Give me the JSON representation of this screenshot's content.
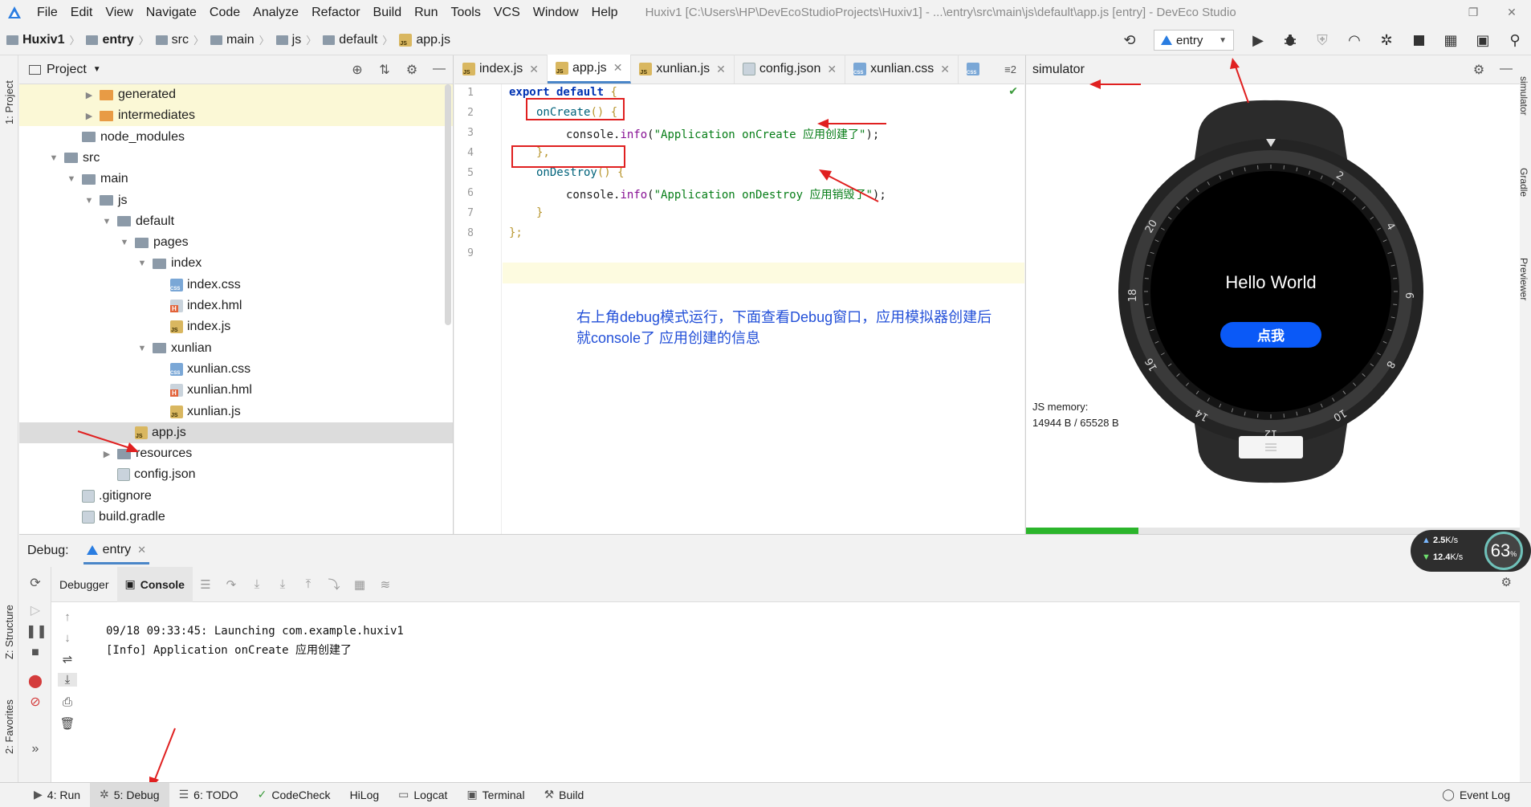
{
  "menu": {
    "items": [
      "File",
      "Edit",
      "View",
      "Navigate",
      "Code",
      "Analyze",
      "Refactor",
      "Build",
      "Run",
      "Tools",
      "VCS",
      "Window",
      "Help"
    ],
    "window_title": "Huxiv1 [C:\\Users\\HP\\DevEcoStudioProjects\\Huxiv1] - ...\\entry\\src\\main\\js\\default\\app.js [entry] - DevEco Studio"
  },
  "breadcrumb": [
    "Huxiv1",
    "entry",
    "src",
    "main",
    "js",
    "default",
    "app.js"
  ],
  "toolbar": {
    "run_config": "entry"
  },
  "left_strip": {
    "project": "1: Project",
    "structure": "Z: Structure",
    "favorites": "2: Favorites"
  },
  "project_panel": {
    "title": "Project",
    "tree": [
      {
        "label": "generated",
        "depth": 3,
        "type": "folder-orange",
        "arrow": "▶"
      },
      {
        "label": "intermediates",
        "depth": 3,
        "type": "folder-orange",
        "arrow": "▶"
      },
      {
        "label": "node_modules",
        "depth": 2,
        "type": "folder",
        "arrow": ""
      },
      {
        "label": "src",
        "depth": 1,
        "type": "folder",
        "arrow": "▼"
      },
      {
        "label": "main",
        "depth": 2,
        "type": "folder",
        "arrow": "▼"
      },
      {
        "label": "js",
        "depth": 3,
        "type": "folder",
        "arrow": "▼"
      },
      {
        "label": "default",
        "depth": 4,
        "type": "folder",
        "arrow": "▼"
      },
      {
        "label": "pages",
        "depth": 5,
        "type": "folder",
        "arrow": "▼"
      },
      {
        "label": "index",
        "depth": 6,
        "type": "folder",
        "arrow": "▼"
      },
      {
        "label": "index.css",
        "depth": 7,
        "type": "css",
        "arrow": ""
      },
      {
        "label": "index.hml",
        "depth": 7,
        "type": "hml",
        "arrow": ""
      },
      {
        "label": "index.js",
        "depth": 7,
        "type": "js",
        "arrow": ""
      },
      {
        "label": "xunlian",
        "depth": 6,
        "type": "folder",
        "arrow": "▼"
      },
      {
        "label": "xunlian.css",
        "depth": 7,
        "type": "css",
        "arrow": ""
      },
      {
        "label": "xunlian.hml",
        "depth": 7,
        "type": "hml",
        "arrow": ""
      },
      {
        "label": "xunlian.js",
        "depth": 7,
        "type": "js",
        "arrow": ""
      },
      {
        "label": "app.js",
        "depth": 5,
        "type": "js",
        "arrow": ""
      },
      {
        "label": "resources",
        "depth": 4,
        "type": "folder",
        "arrow": "▶"
      },
      {
        "label": "config.json",
        "depth": 4,
        "type": "json",
        "arrow": ""
      },
      {
        "label": ".gitignore",
        "depth": 2,
        "type": "file",
        "arrow": ""
      },
      {
        "label": "build.gradle",
        "depth": 2,
        "type": "file",
        "arrow": ""
      }
    ]
  },
  "editor": {
    "tabs": [
      {
        "label": "index.js",
        "icon": "js"
      },
      {
        "label": "app.js",
        "icon": "js"
      },
      {
        "label": "xunlian.js",
        "icon": "js"
      },
      {
        "label": "config.json",
        "icon": "json"
      },
      {
        "label": "xunlian.css",
        "icon": "css"
      }
    ],
    "tab_overflow": "≡2",
    "line_numbers": [
      "1",
      "2",
      "3",
      "4",
      "5",
      "6",
      "7",
      "8",
      "9"
    ],
    "code": {
      "l1_kw": "export default",
      "l1_brace": " {",
      "l2_fn": "onCreate",
      "l2_rest": "() {",
      "l3_obj": "console.",
      "l3_fn": "info",
      "l3_open": "(",
      "l3_str": "\"Application onCreate 应用创建了\"",
      "l3_close": ");",
      "l4": "},",
      "l5_fn": "onDestroy",
      "l5_rest": "() {",
      "l6_obj": "console.",
      "l6_fn": "info",
      "l6_open": "(",
      "l6_str": "\"Application onDestroy 应用销毁了\"",
      "l6_close": ");",
      "l7": "}",
      "l8": "};"
    },
    "annotation_line1": "右上角debug模式运行，下面查看Debug窗口，应用模拟器创建后",
    "annotation_line2": "就console了 应用创建的信息"
  },
  "simulator": {
    "title": "simulator",
    "screen_text": "Hello World",
    "button_label": "点我",
    "bezel_numbers": [
      "2",
      "4",
      "6",
      "8",
      "10",
      "12",
      "14",
      "16",
      "18",
      "20"
    ],
    "memory_label": "JS memory:",
    "memory_value": "14944 B / 65528 B",
    "memory_fraction": 0.228,
    "side_tabs": [
      "simulator",
      "Gradle",
      "Previewer"
    ]
  },
  "debug": {
    "label": "Debug:",
    "tab": "entry",
    "console_tabs": {
      "debugger": "Debugger",
      "console": "Console"
    },
    "output": [
      "09/18 09:33:45: Launching com.example.huxiv1",
      "[Info] Application onCreate 应用创建了"
    ]
  },
  "network_widget": {
    "upload": "2.5",
    "upload_unit": "K/s",
    "download": "12.4",
    "download_unit": "K/s",
    "percent": "63",
    "percent_unit": "%"
  },
  "statusbar": {
    "run": "4: Run",
    "debug": "5: Debug",
    "todo": "6: TODO",
    "codecheck": "CodeCheck",
    "hilog": "HiLog",
    "logcat": "Logcat",
    "terminal": "Terminal",
    "build": "Build",
    "eventlog": "Event Log"
  },
  "colors": {
    "accent": "#4a86c8",
    "annotation": "#e02020",
    "note_text": "#2350d8",
    "button_blue": "#0a59f7",
    "memory_bar": "#2bb52b"
  }
}
